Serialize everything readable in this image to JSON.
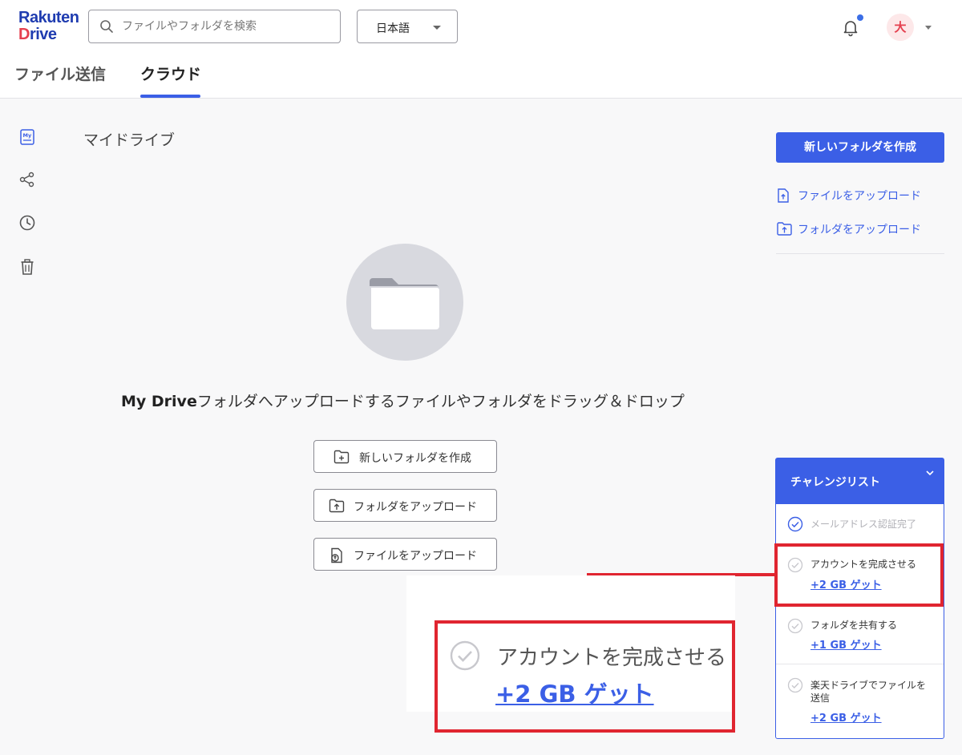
{
  "header": {
    "logo_line1": "Rakuten",
    "logo_line2_accent": "D",
    "logo_line2_rest": "rive",
    "search_placeholder": "ファイルやフォルダを検索",
    "language": "日本語",
    "avatar_initial": "大",
    "tabs": [
      {
        "label": "ファイル送信"
      },
      {
        "label": "クラウド",
        "active": true
      }
    ]
  },
  "sidebar": {
    "items": [
      {
        "icon": "my-drive-icon",
        "active": true
      },
      {
        "icon": "share-icon"
      },
      {
        "icon": "clock-icon"
      },
      {
        "icon": "trash-icon"
      }
    ]
  },
  "main": {
    "breadcrumb": "マイドライブ",
    "empty_bold": "My Drive",
    "empty_rest": "フォルダへアップロードするファイルやフォルダをドラッグ＆ドロップ",
    "actions": [
      {
        "label": "新しいフォルダを作成",
        "icon": "folder-plus-icon"
      },
      {
        "label": "フォルダをアップロード",
        "icon": "folder-upload-icon"
      },
      {
        "label": "ファイルをアップロード",
        "icon": "file-upload-icon"
      }
    ]
  },
  "right_panel": {
    "new_folder": "新しいフォルダを作成",
    "upload_file": "ファイルをアップロード",
    "upload_folder": "フォルダをアップロード"
  },
  "challenge_list": {
    "title": "チャレンジリスト",
    "items": [
      {
        "name": "メールアドレス認証完了",
        "reward": "",
        "done": true
      },
      {
        "name": "アカウントを完成させる",
        "reward": "+2 GB ゲット",
        "highlighted": true
      },
      {
        "name": "フォルダを共有する",
        "reward": "+1 GB ゲット"
      },
      {
        "name": "楽天ドライブでファイルを送信",
        "name_line1": "楽天ドライブでファイルを",
        "name_line2": "送信",
        "reward": "+2 GB ゲット"
      }
    ]
  },
  "zoom_callout": {
    "name": "アカウントを完成させる",
    "reward": "+2 GB ゲット"
  },
  "colors": {
    "accent": "#3b5fe6",
    "highlight": "#e02530",
    "logo": "#1f3cb0"
  }
}
